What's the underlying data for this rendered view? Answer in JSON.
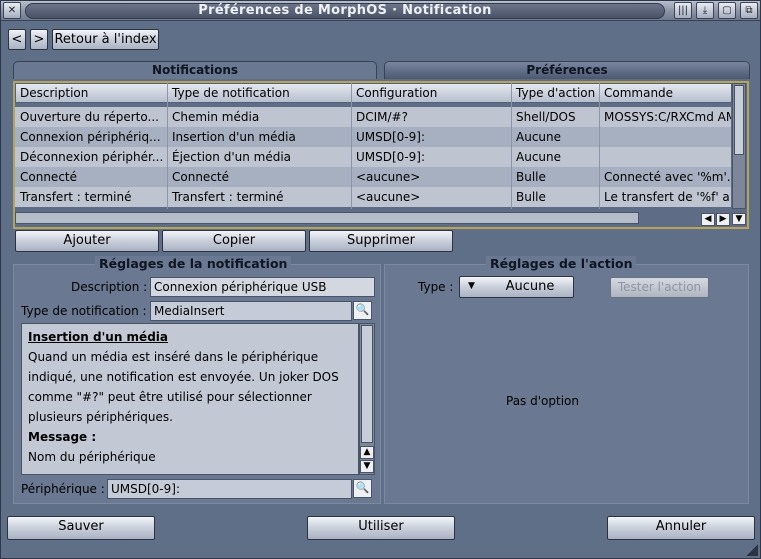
{
  "window": {
    "title": "Préférences de MorphOS · Notification"
  },
  "nav": {
    "prev_label": "<",
    "next_label": ">",
    "index_label": "Retour à l'index"
  },
  "tabs": [
    {
      "label": "Notifications"
    },
    {
      "label": "Préférences"
    }
  ],
  "list": {
    "headers": [
      "Description",
      "Type de notification",
      "Configuration",
      "Type d'action",
      "Commande"
    ],
    "rows": [
      [
        "Ouverture du réperto...",
        "Chemin média",
        "DCIM/#?",
        "Shell/DOS",
        "MOSSYS:C/RXCmd AM"
      ],
      [
        "Connexion périphériq...",
        "Insertion d'un média",
        "UMSD[0-9]:",
        "Aucune",
        ""
      ],
      [
        "Déconnexion périphér...",
        "Éjection d'un média",
        "UMSD[0-9]:",
        "Aucune",
        ""
      ],
      [
        "Connecté",
        "Connecté",
        "<aucune>",
        "Bulle",
        "Connecté avec '%m'."
      ],
      [
        "Transfert : terminé",
        "Transfert : terminé",
        "<aucune>",
        "Bulle",
        "Le transfert de '%f' a"
      ]
    ]
  },
  "list_buttons": {
    "add": "Ajouter",
    "copy": "Copier",
    "delete": "Supprimer"
  },
  "notif_settings": {
    "title": "Réglages de la notification",
    "description_label": "Description :",
    "description_value": "Connexion périphérique USB",
    "type_label": "Type de notification :",
    "type_value": "MediaInsert",
    "info_title": "Insertion d'un média",
    "info_text": "Quand un média est inséré dans le périphérique indiqué, une notification est envoyée. Un joker DOS comme \"#?\" peut être utilisé pour sélectionner plusieurs périphériques.",
    "info_message_label": "Message :",
    "info_message_text": "Nom du périphérique",
    "device_label": "Périphérique :",
    "device_value": "UMSD[0-9]:"
  },
  "action_settings": {
    "title": "Réglages de l'action",
    "type_label": "Type :",
    "type_value": "Aucune",
    "test_label": "Tester l'action",
    "no_option": "Pas d'option"
  },
  "footer": {
    "save": "Sauver",
    "use": "Utiliser",
    "cancel": "Annuler"
  }
}
